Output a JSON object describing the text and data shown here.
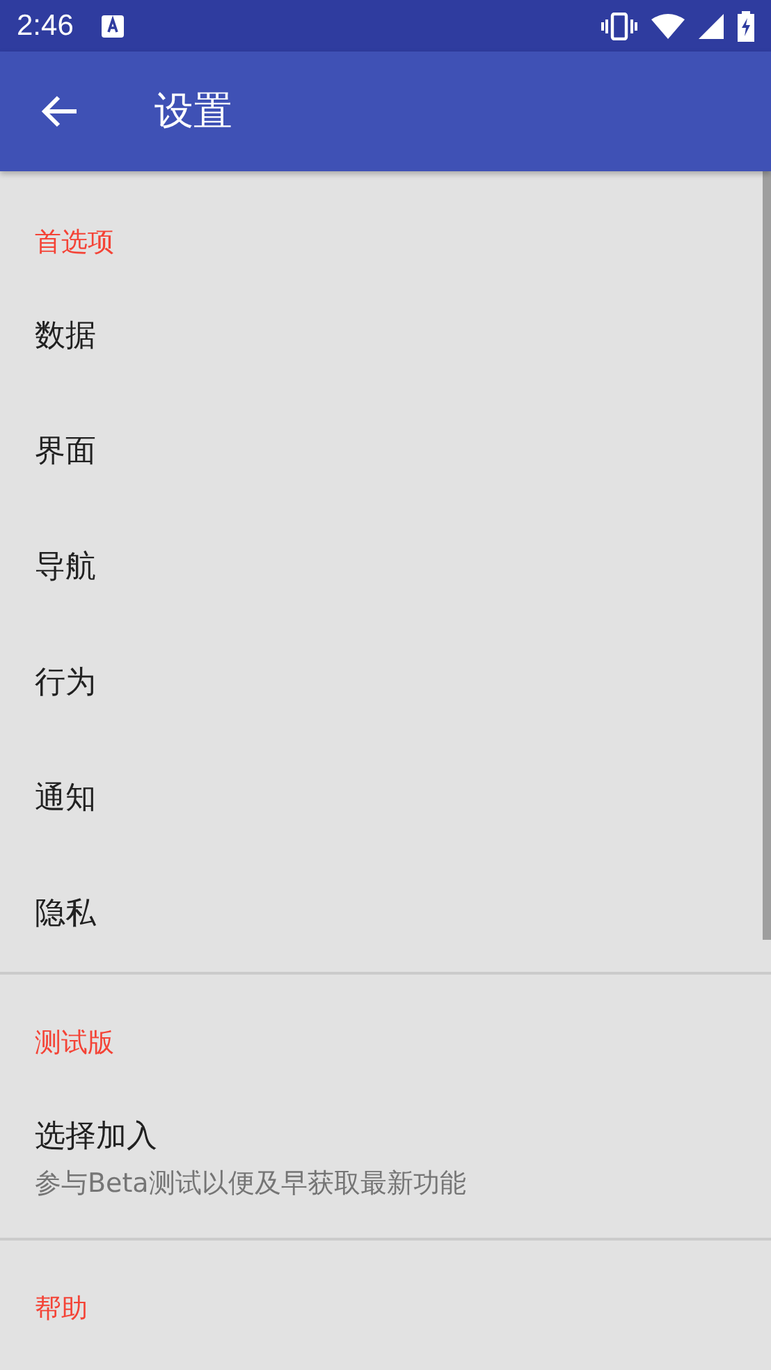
{
  "status_bar": {
    "time": "2:46"
  },
  "app_bar": {
    "title": "设置"
  },
  "sections": [
    {
      "header": "首选项",
      "items": [
        {
          "title": "数据"
        },
        {
          "title": "界面"
        },
        {
          "title": "导航"
        },
        {
          "title": "行为"
        },
        {
          "title": "通知"
        },
        {
          "title": "隐私"
        }
      ]
    },
    {
      "header": "测试版",
      "items": [
        {
          "title": "选择加入",
          "summary": "参与Beta测试以便及早获取最新功能"
        }
      ]
    },
    {
      "header": "帮助"
    }
  ]
}
